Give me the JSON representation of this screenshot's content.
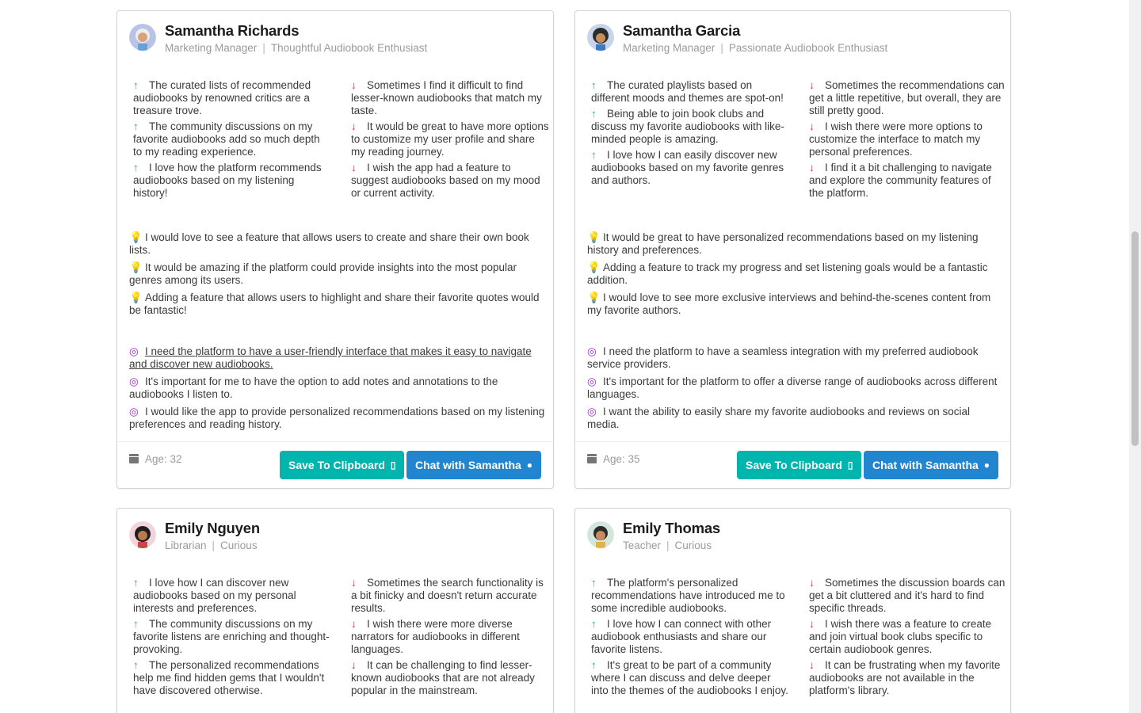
{
  "colors": {
    "save": "#00b5ad",
    "chat": "#2185d0",
    "up": "#21ba45",
    "down": "#db2828",
    "bulb": "#f2c21b",
    "goal": "#a333c8"
  },
  "icons": {
    "up": "arrow-up-icon",
    "down": "arrow-down-icon",
    "idea": "lightbulb-icon",
    "goal": "bullseye-icon",
    "age": "calendar-icon",
    "save": "clipboard-icon",
    "chat": "comment-icon"
  },
  "cards": [
    {
      "name": "Samantha Richards",
      "role": "Marketing Manager",
      "trait": "Thoughtful Audiobook Enthusiast",
      "pros": [
        "The curated lists of recommended audiobooks by renowned critics are a treasure trove.",
        "The community discussions on my favorite audiobooks add so much depth to my reading experience.",
        "I love how the platform recommends audiobooks based on my listening history!"
      ],
      "cons": [
        "Sometimes I find it difficult to find lesser-known audiobooks that match my taste.",
        "It would be great to have more options to customize my user profile and share my reading journey.",
        "I wish the app had a feature to suggest audiobooks based on my mood or current activity."
      ],
      "ideas": [
        "I would love to see a feature that allows users to create and share their own book lists.",
        "It would be amazing if the platform could provide insights into the most popular genres among its users.",
        "Adding a feature that allows users to highlight and share their favorite quotes would be fantastic!"
      ],
      "goals": [
        "I need the platform to have a user-friendly interface that makes it easy to navigate and discover new audiobooks.",
        "It's important for me to have the option to add notes and annotations to the audiobooks I listen to.",
        "I would like the app to provide personalized recommendations based on my listening preferences and reading history."
      ],
      "age": "Age: 32",
      "save_label": "Save To Clipboard",
      "chat_label": "Chat with Samantha"
    },
    {
      "name": "Samantha Garcia",
      "role": "Marketing Manager",
      "trait": "Passionate Audiobook Enthusiast",
      "pros": [
        "The curated playlists based on different moods and themes are spot-on!",
        "Being able to join book clubs and discuss my favorite audiobooks with like-minded people is amazing.",
        "I love how I can easily discover new audiobooks based on my favorite genres and authors."
      ],
      "cons": [
        "Sometimes the recommendations can get a little repetitive, but overall, they are still pretty good.",
        "I wish there were more options to customize the interface to match my personal preferences.",
        "I find it a bit challenging to navigate and explore the community features of the platform."
      ],
      "ideas": [
        "It would be great to have personalized recommendations based on my listening history and preferences.",
        "Adding a feature to track my progress and set listening goals would be a fantastic addition.",
        "I would love to see more exclusive interviews and behind-the-scenes content from my favorite authors."
      ],
      "goals": [
        "I need the platform to have a seamless integration with my preferred audiobook service providers.",
        "It's important for the platform to offer a diverse range of audiobooks across different languages.",
        "I want the ability to easily share my favorite audiobooks and reviews on social media."
      ],
      "age": "Age: 35",
      "save_label": "Save To Clipboard",
      "chat_label": "Chat with Samantha"
    },
    {
      "name": "Emily Nguyen",
      "role": "Librarian",
      "trait": "Curious",
      "pros": [
        "I love how I can discover new audiobooks based on my personal interests and preferences.",
        "The community discussions on my favorite listens are enriching and thought-provoking.",
        "The personalized recommendations help me find hidden gems that I wouldn't have discovered otherwise."
      ],
      "cons": [
        "Sometimes the search functionality is a bit finicky and doesn't return accurate results.",
        "I wish there were more diverse narrators for audiobooks in different languages.",
        "It can be challenging to find lesser-known audiobooks that are not already popular in the mainstream."
      ]
    },
    {
      "name": "Emily Thomas",
      "role": "Teacher",
      "trait": "Curious",
      "pros": [
        "The platform's personalized recommendations have introduced me to some incredible audiobooks.",
        "I love how I can connect with other audiobook enthusiasts and share our favorite listens.",
        "It's great to be part of a community where I can discuss and delve deeper into the themes of the audiobooks I enjoy."
      ],
      "cons": [
        "Sometimes the discussion boards can get a bit cluttered and it's hard to find specific threads.",
        "I wish there was a feature to create and join virtual book clubs specific to certain audiobook genres.",
        "It can be frustrating when my favorite audiobooks are not available in the platform's library."
      ]
    }
  ]
}
